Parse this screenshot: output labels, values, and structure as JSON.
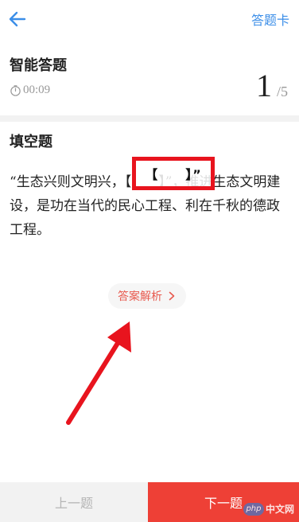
{
  "header": {
    "back_icon": "arrow-left-icon",
    "answer_card_label": "答题卡"
  },
  "quiz": {
    "title": "智能答题",
    "timer": "00:09",
    "timer_icon": "stopwatch-icon",
    "current_question": "1",
    "total_questions": "/5"
  },
  "question": {
    "type_label": "填空题",
    "text": "“生态兴则文明兴，【　　】”，推进生态文明建设，是功在当代的民心工程、利在千秋的德政工程。",
    "blank_text": "【　　】”"
  },
  "analysis": {
    "label": "答案解析",
    "icon": "chevron-right-icon"
  },
  "annotation": {
    "color": "#e8141e"
  },
  "footer": {
    "prev_label": "上一题",
    "next_label": "下一题"
  },
  "watermark": {
    "logo": "php",
    "text": "中文网"
  },
  "colors": {
    "accent_blue": "#3b8ee8",
    "accent_red": "#ee4036"
  }
}
